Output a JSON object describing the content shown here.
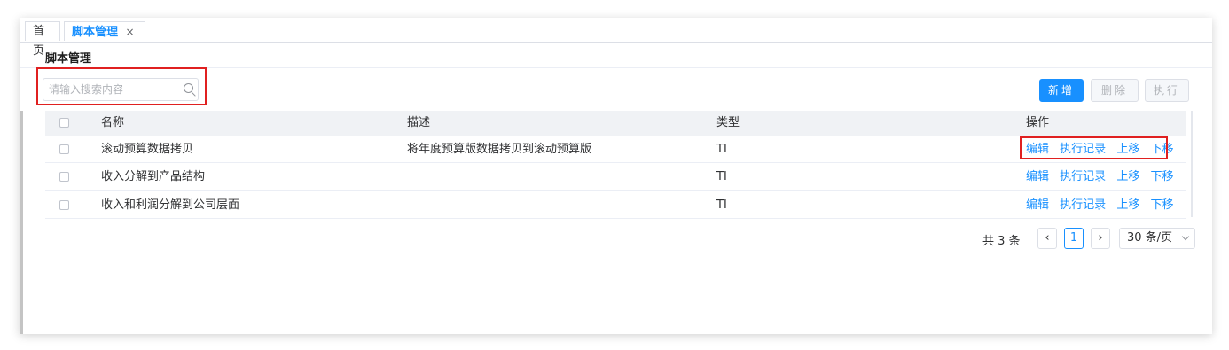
{
  "tabs": [
    {
      "label": "首页",
      "active": false
    },
    {
      "label": "脚本管理",
      "active": true,
      "close": "×"
    }
  ],
  "page_title": "脚本管理",
  "search": {
    "placeholder": "请输入搜索内容",
    "value": ""
  },
  "toolbar": {
    "add_label": "新增",
    "delete_label": "删除",
    "execute_label": "执行"
  },
  "table": {
    "columns": {
      "name": "名称",
      "description": "描述",
      "type": "类型",
      "actions": "操作"
    },
    "rows": [
      {
        "name": "滚动预算数据拷贝",
        "description": "将年度预算版数据拷贝到滚动预算版",
        "type": "TI"
      },
      {
        "name": "收入分解到产品结构",
        "description": "",
        "type": "TI"
      },
      {
        "name": "收入和利润分解到公司层面",
        "description": "",
        "type": "TI"
      }
    ],
    "row_actions": {
      "edit": "编辑",
      "history": "执行记录",
      "up": "上移",
      "down": "下移"
    }
  },
  "pagination": {
    "total": "共 3 条",
    "current_page": "1",
    "page_size": "30 条/页"
  },
  "colors": {
    "accent": "#1890ff",
    "highlight": "#e02020"
  }
}
